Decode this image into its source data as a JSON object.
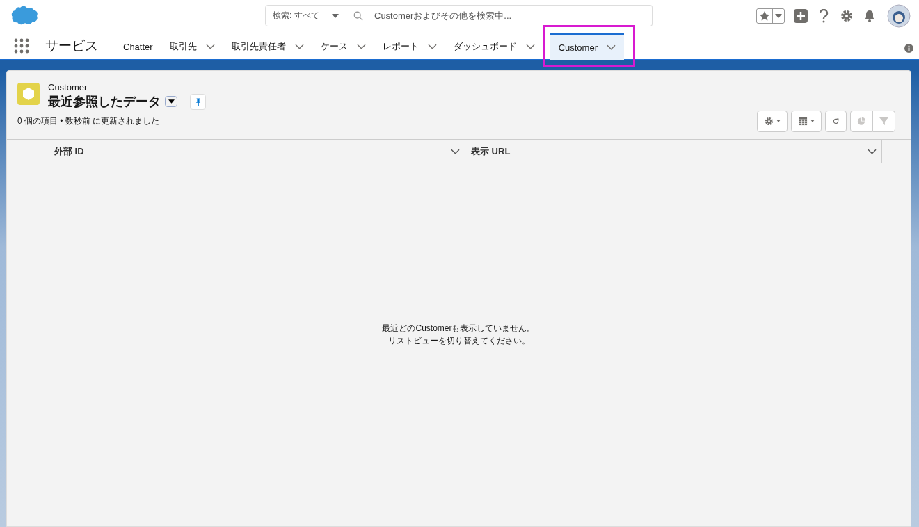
{
  "search": {
    "scope": "検索: すべて",
    "placeholder": "Customerおよびその他を検索中..."
  },
  "app_name": "サービス",
  "tabs": [
    {
      "label": "Chatter",
      "selected": false,
      "has_menu": false,
      "highlighted": false
    },
    {
      "label": "取引先",
      "selected": false,
      "has_menu": true,
      "highlighted": false
    },
    {
      "label": "取引先責任者",
      "selected": false,
      "has_menu": true,
      "highlighted": false
    },
    {
      "label": "ケース",
      "selected": false,
      "has_menu": true,
      "highlighted": false
    },
    {
      "label": "レポート",
      "selected": false,
      "has_menu": true,
      "highlighted": false
    },
    {
      "label": "ダッシュボード",
      "selected": false,
      "has_menu": true,
      "highlighted": false
    },
    {
      "label": "Customer",
      "selected": true,
      "has_menu": true,
      "highlighted": true
    }
  ],
  "list_view": {
    "object": "Customer",
    "title": "最近参照したデータ",
    "status": "0 個の項目 • 数秒前 に更新されました"
  },
  "toolbar": [
    {
      "kind": "settings",
      "disabled": false
    },
    {
      "kind": "display",
      "disabled": false
    },
    {
      "kind": "refresh",
      "disabled": false
    },
    {
      "kind": "chart",
      "disabled": true
    },
    {
      "kind": "filter",
      "disabled": true
    }
  ],
  "table": {
    "columns": [
      "外部 ID",
      "表示 URL"
    ]
  },
  "empty_message": [
    "最近どのCustomerも表示していません。",
    "リストビューを切り替えてください。"
  ]
}
